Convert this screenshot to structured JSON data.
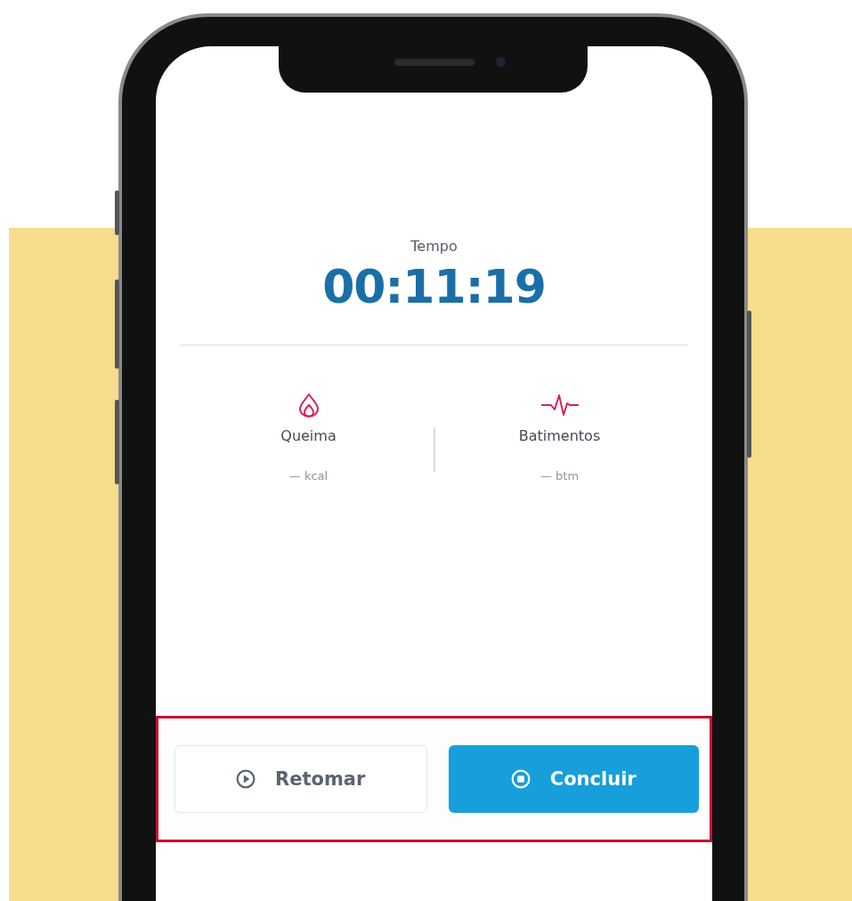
{
  "workout": {
    "time_label": "Tempo",
    "time": "00:11:19"
  },
  "stats": [
    {
      "kind": "burn",
      "label": "Queima",
      "value": "— kcal"
    },
    {
      "kind": "heart",
      "label": "Batimentos",
      "value": "— btm"
    }
  ],
  "buttons": [
    {
      "kind": "secondary",
      "label": "Retomar"
    },
    {
      "kind": "primary",
      "label": "Concluir"
    }
  ]
}
